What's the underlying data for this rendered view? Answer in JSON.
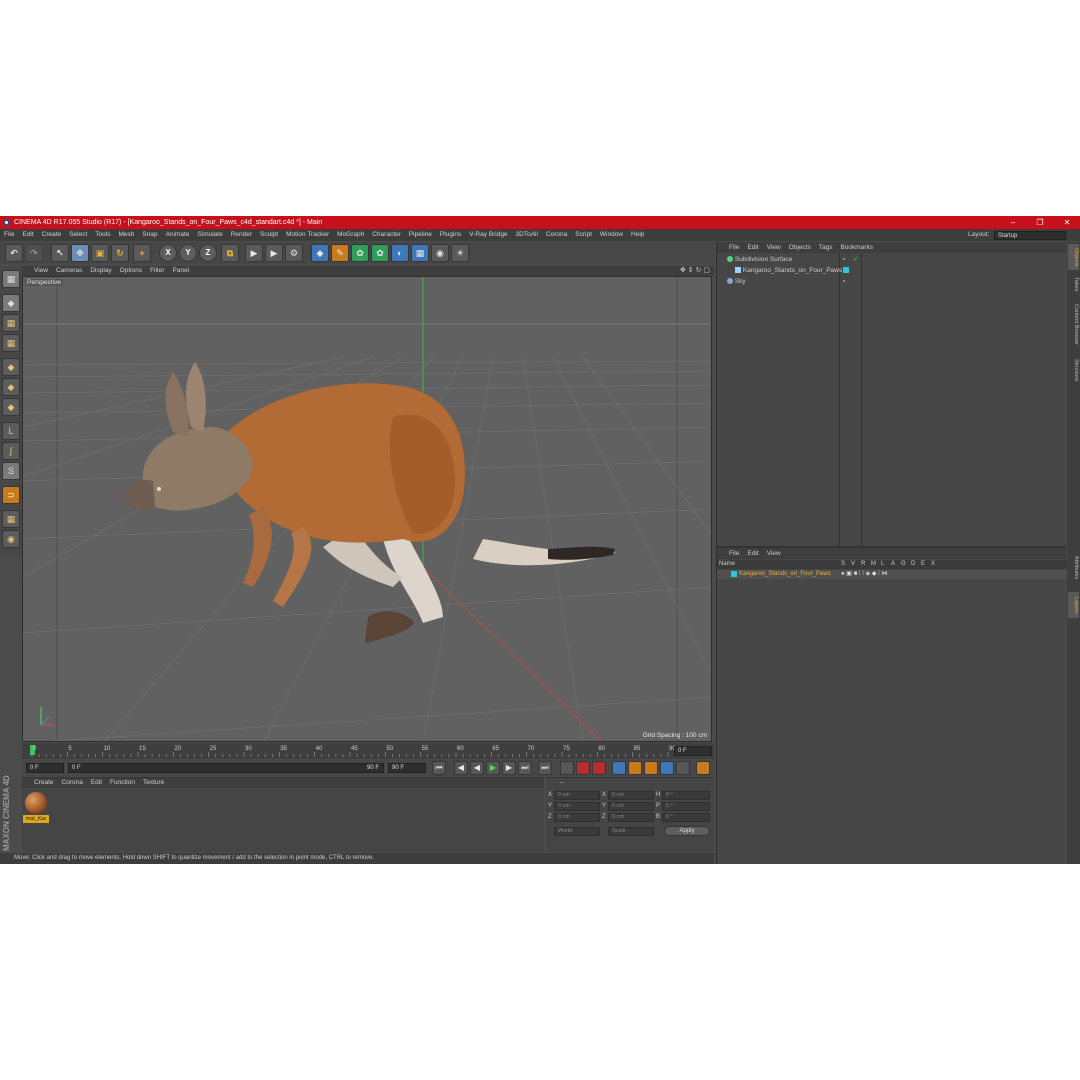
{
  "window": {
    "title": "CINEMA 4D R17.055 Studio (R17) - [Kangaroo_Stands_on_Four_Paws_c4d_standart.c4d *] - Main",
    "minimize": "–",
    "maximize": "❐",
    "close": "✕"
  },
  "menu": [
    "File",
    "Edit",
    "Create",
    "Select",
    "Tools",
    "Mesh",
    "Snap",
    "Animate",
    "Simulate",
    "Render",
    "Sculpt",
    "Motion Tracker",
    "MoGraph",
    "Character",
    "Pipeline",
    "Plugins",
    "V-Ray Bridge",
    "3DToAll",
    "Corona",
    "Script",
    "Window",
    "Help"
  ],
  "layout": {
    "label": "Layout:",
    "value": "Startup"
  },
  "toolbar": {
    "undo": "↶",
    "redo": "↷",
    "select": "↖",
    "move": "✥",
    "scale": "▣",
    "rotate": "↻",
    "add": "+",
    "x": "X",
    "y": "Y",
    "z": "Z",
    "coord": "⧉",
    "render_region": "▶",
    "render_view": "▶",
    "render_settings": "⚙",
    "cube": "◆",
    "pen": "✎",
    "subdiv": "✿",
    "cloner": "✿",
    "deformer": "◐",
    "floor": "▦",
    "camera": "◉",
    "light": "☀"
  },
  "left_tools": [
    "▦",
    "◆",
    "▦",
    "▦",
    "◆",
    "◆",
    "◆",
    "L",
    "∫",
    "S",
    "⊃",
    "▦",
    "◉"
  ],
  "viewport": {
    "menu": [
      "View",
      "Cameras",
      "Display",
      "Options",
      "Filter",
      "Panel"
    ],
    "label": "Perspective",
    "grid_spacing": "Grid Spacing : 100 cm",
    "nav_icons": "✥ ⇕ ↻ ▢"
  },
  "timeline": {
    "ticks": [
      "0",
      "5",
      "10",
      "15",
      "20",
      "25",
      "30",
      "35",
      "40",
      "45",
      "50",
      "55",
      "60",
      "65",
      "70",
      "75",
      "80",
      "85",
      "90"
    ],
    "current": "0 F"
  },
  "frame_controls": {
    "start": "0 F",
    "min": "0 F",
    "max": "90 F",
    "end": "90 F",
    "buttons": [
      "⏮",
      "◀",
      "◀",
      "▶",
      "▶",
      "⏭",
      "⏭"
    ]
  },
  "material_manager": {
    "menu": [
      "Create",
      "Corona",
      "Edit",
      "Function",
      "Texture"
    ],
    "material_name": "mat_Kar"
  },
  "coordinates": {
    "rows": [
      {
        "a": "X",
        "av": "0 cm",
        "b": "X",
        "bv": "0 cm",
        "c": "H",
        "cv": "0 °"
      },
      {
        "a": "Y",
        "av": "0 cm",
        "b": "Y",
        "bv": "0 cm",
        "c": "P",
        "cv": "0 °"
      },
      {
        "a": "Z",
        "av": "0 cm",
        "b": "Z",
        "bv": "0 cm",
        "c": "B",
        "cv": "0 °"
      }
    ],
    "mode": "World",
    "scale": "Scale",
    "apply": "Apply",
    "header": "--"
  },
  "status": "Move: Click and drag to move elements. Hold down SHIFT to quantize movement / add to the selection in point mode, CTRL to remove.",
  "maxon": "MAXON CINEMA 4D",
  "object_manager": {
    "menu": [
      "File",
      "Edit",
      "View",
      "Objects",
      "Tags",
      "Bookmarks"
    ],
    "objects": [
      {
        "name": "Subdivision Surface",
        "color": "#5ad07a"
      },
      {
        "name": "Kangaroo_Stands_on_Four_Paws",
        "color": "#9ad0ff"
      },
      {
        "name": "Sky",
        "color": "#8aa8d0"
      }
    ]
  },
  "layer_manager": {
    "menu": [
      "File",
      "Edit",
      "View"
    ],
    "columns": [
      "Name",
      "S",
      "V",
      "R",
      "M",
      "L",
      "A",
      "G",
      "D",
      "E",
      "X"
    ],
    "layer": "Kangaroo_Stands_on_Four_Paws",
    "layer_color": "#2ec6d8"
  },
  "side_tabs": [
    "Objects",
    "Takes",
    "Content Browser",
    "Structure",
    "Attributes",
    "Layers"
  ]
}
